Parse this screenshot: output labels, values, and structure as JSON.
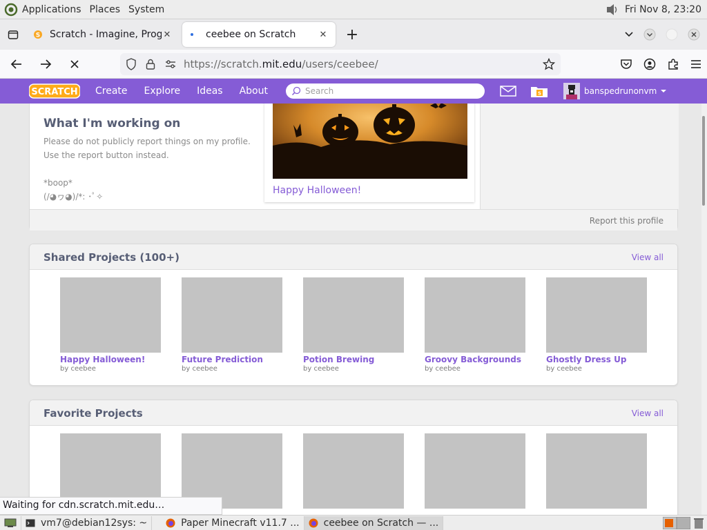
{
  "desktop": {
    "menus": [
      "Applications",
      "Places",
      "System"
    ],
    "clock": "Fri Nov  8, 23:20"
  },
  "browser": {
    "tabs": [
      {
        "title": "Scratch - Imagine, Progra",
        "close": "✕"
      },
      {
        "title": "ceebee on Scratch",
        "close": "✕"
      }
    ],
    "new_tab": "+",
    "url": {
      "prefix": "https://scratch.",
      "host": "mit.edu",
      "path": "/users/ceebee/"
    },
    "status": "Waiting for cdn.scratch.mit.edu…"
  },
  "scratch": {
    "nav": [
      "Create",
      "Explore",
      "Ideas",
      "About"
    ],
    "search_placeholder": "Search",
    "username": "banspedrunonvm",
    "brand_color": "#855cd6"
  },
  "profile": {
    "working_title": "What I'm working on",
    "working_lines": [
      "Please do not publicly report things on my profile.",
      "Use the report button instead.",
      "",
      "*boop*",
      "(/◕ヮ◕)/*: ･ﾟ✧"
    ],
    "featured_title": "Happy Halloween!",
    "report": "Report this profile"
  },
  "shared": {
    "title": "Shared Projects (100+)",
    "view_all": "View all",
    "projects": [
      {
        "title": "Happy Halloween!",
        "by": "by ceebee"
      },
      {
        "title": "Future Prediction",
        "by": "by ceebee"
      },
      {
        "title": "Potion Brewing",
        "by": "by ceebee"
      },
      {
        "title": "Groovy Backgrounds",
        "by": "by ceebee"
      },
      {
        "title": "Ghostly Dress Up",
        "by": "by ceebee"
      }
    ]
  },
  "favorites": {
    "title": "Favorite Projects",
    "view_all": "View all"
  },
  "taskbar": {
    "items": [
      "vm7@debian12sys: ~",
      "Paper Minecraft v11.7 ...",
      "ceebee on Scratch — ..."
    ]
  }
}
